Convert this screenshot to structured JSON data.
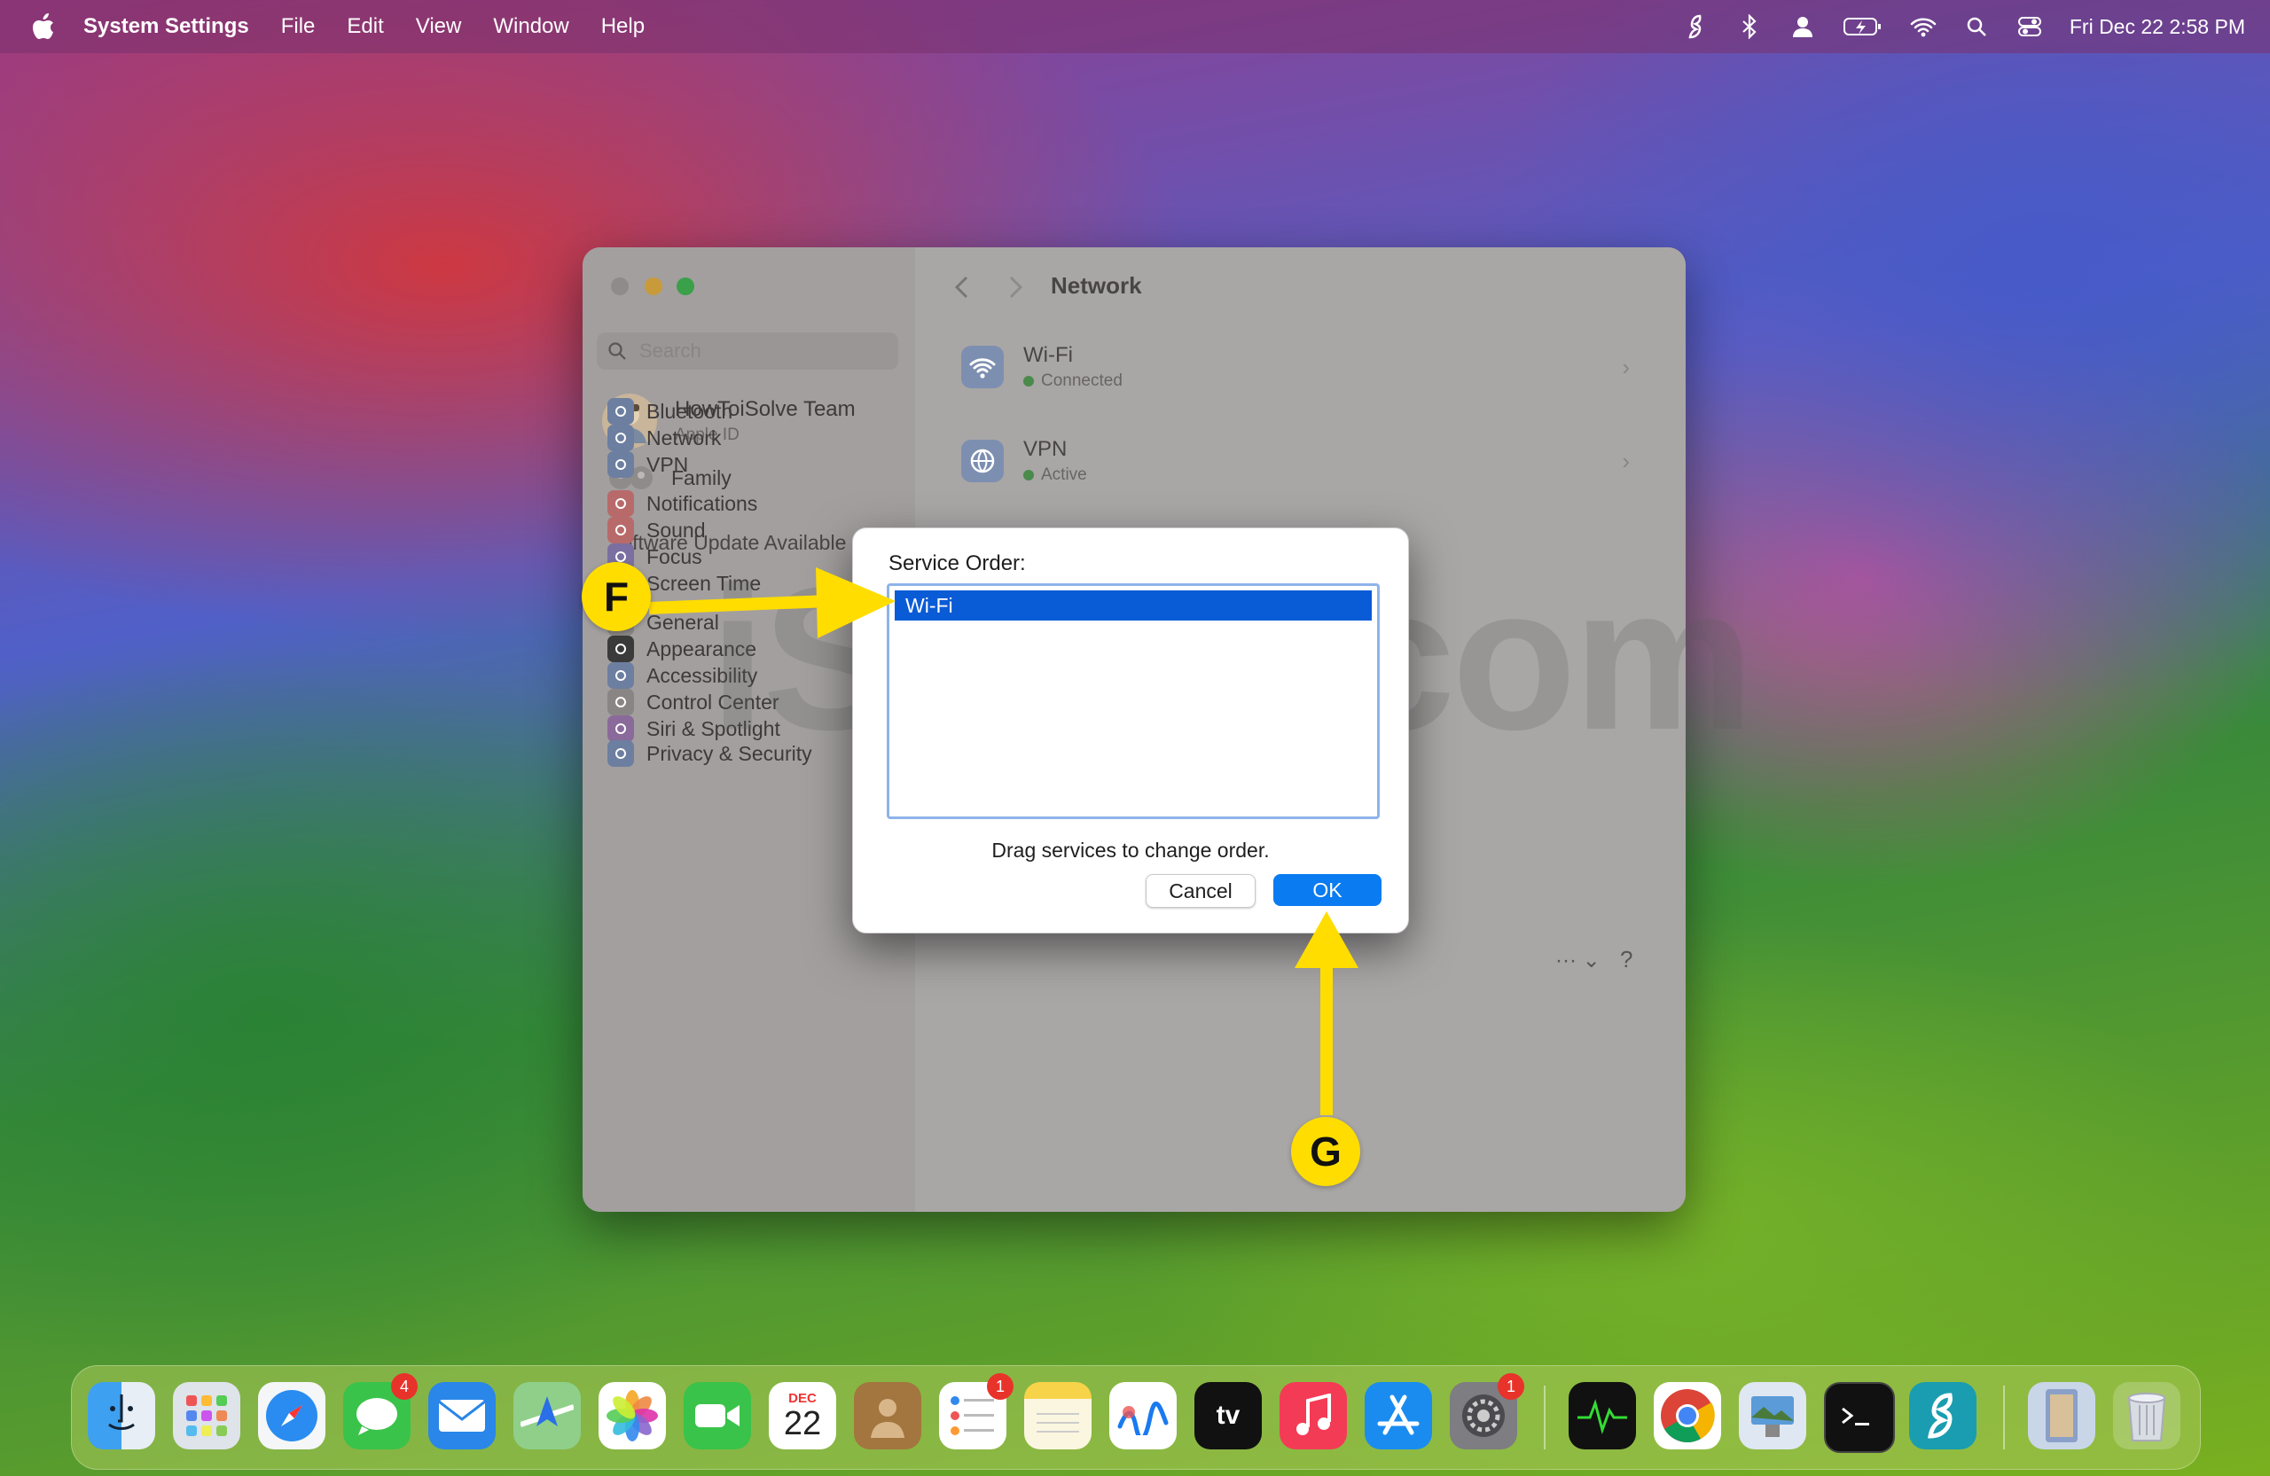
{
  "menubar": {
    "app_name": "System Settings",
    "menus": [
      "File",
      "Edit",
      "View",
      "Window",
      "Help"
    ],
    "clock": "Fri Dec 22  2:58 PM"
  },
  "sidebar": {
    "search_placeholder": "Search",
    "account_name": "HowToiSolve Team",
    "account_sub": "Apple ID",
    "family_label": "Family",
    "update_label": "Software Update Available",
    "items": [
      {
        "label": "Bluetooth",
        "icon": "bluetooth-icon",
        "color": "#6d7fa0"
      },
      {
        "label": "Network",
        "icon": "globe-icon",
        "color": "#6d7fa0"
      },
      {
        "label": "VPN",
        "icon": "vpn-icon",
        "color": "#6d7fa0"
      },
      {
        "label": "Notifications",
        "icon": "bell-icon",
        "color": "#b86a6a"
      },
      {
        "label": "Sound",
        "icon": "speaker-icon",
        "color": "#b86a6a"
      },
      {
        "label": "Focus",
        "icon": "moon-icon",
        "color": "#7a6fa0"
      },
      {
        "label": "Screen Time",
        "icon": "hourglass-icon",
        "color": "#7a6fa0"
      },
      {
        "label": "General",
        "icon": "gear-icon",
        "color": "#8a8585"
      },
      {
        "label": "Appearance",
        "icon": "appearance-icon",
        "color": "#3a3a3a"
      },
      {
        "label": "Accessibility",
        "icon": "accessibility-icon",
        "color": "#6d7fa0"
      },
      {
        "label": "Control Center",
        "icon": "control-center-icon",
        "color": "#8a8585"
      },
      {
        "label": "Siri & Spotlight",
        "icon": "siri-icon",
        "color": "#8a6a9a"
      },
      {
        "label": "Privacy & Security",
        "icon": "hand-icon",
        "color": "#6d7fa0"
      }
    ]
  },
  "main": {
    "title": "Network",
    "rows": [
      {
        "label": "Wi-Fi",
        "status": "Connected",
        "icon": "wifi-icon"
      },
      {
        "label": "VPN",
        "status": "Active",
        "icon": "vpn-icon"
      }
    ],
    "more_label": "··· ⌄",
    "help_label": "?"
  },
  "dialog": {
    "title": "Service Order:",
    "services": [
      "Wi-Fi"
    ],
    "hint": "Drag services to change order.",
    "cancel_label": "Cancel",
    "ok_label": "OK"
  },
  "watermark": "iSolve.com",
  "callouts": {
    "f": "F",
    "g": "G"
  },
  "colors": {
    "callout": "#ffdd00",
    "accent": "#0a7bf0",
    "selection": "#0a5bd6"
  },
  "dock": {
    "calendar_month": "DEC",
    "calendar_day": "22",
    "tv_label": "tv",
    "badges": {
      "messages": "4",
      "reminders": "1",
      "settings": "1"
    }
  }
}
